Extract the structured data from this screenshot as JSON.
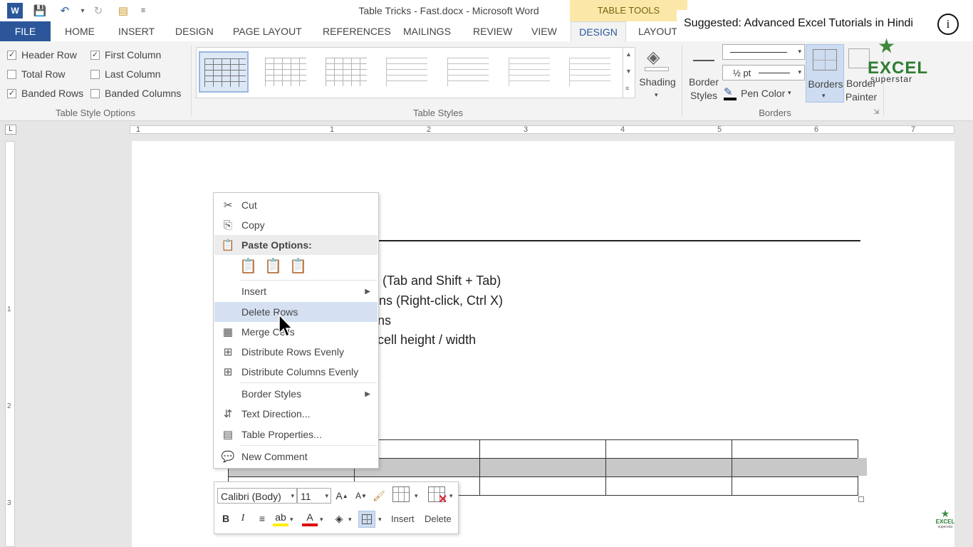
{
  "titlebar": {
    "title": "Table Tricks - Fast.docx - Microsoft Word",
    "table_tools": "TABLE TOOLS"
  },
  "tabs": {
    "file": "FILE",
    "home": "HOME",
    "insert": "INSERT",
    "design": "DESIGN",
    "page_layout": "PAGE LAYOUT",
    "references": "REFERENCES",
    "mailings": "MAILINGS",
    "review": "REVIEW",
    "view": "VIEW",
    "design2": "DESIGN",
    "layout": "LAYOUT"
  },
  "suggested": {
    "text": "Suggested: Advanced Excel Tutorials in Hindi",
    "info": "i"
  },
  "watermark": {
    "main": "EXCEL",
    "sub": "superstar",
    "small": "EXCEL",
    "small_sub": "superstar"
  },
  "style_options": {
    "header_row": {
      "label": "Header Row",
      "checked": "✓"
    },
    "total_row": {
      "label": "Total Row",
      "checked": ""
    },
    "banded_rows": {
      "label": "Banded Rows",
      "checked": "✓"
    },
    "first_column": {
      "label": "First Column",
      "checked": "✓"
    },
    "last_column": {
      "label": "Last Column",
      "checked": ""
    },
    "banded_columns": {
      "label": "Banded Columns",
      "checked": ""
    },
    "group_label": "Table Style Options"
  },
  "table_styles": {
    "group_label": "Table Styles",
    "shading": "Shading"
  },
  "borders": {
    "border_styles_1": "Border",
    "border_styles_2": "Styles",
    "weight": "½ pt",
    "pen_color": "Pen Color",
    "borders": "Borders",
    "painter_1": "Border",
    "painter_2": "Painter",
    "group_label": "Borders"
  },
  "ruler": {
    "marks": [
      "1",
      "1",
      "2",
      "3",
      "4",
      "5",
      "6",
      "7"
    ],
    "vmarks": [
      "1",
      "2",
      "3"
    ]
  },
  "document": {
    "lines": [
      "e (Tab and Shift + Tab)",
      "nns (Right-click, Ctrl X)",
      "ns",
      "cell height / width"
    ]
  },
  "context_menu": {
    "cut": "Cut",
    "copy": "Copy",
    "paste_options": "Paste Options:",
    "insert": "Insert",
    "delete_rows": "Delete Rows",
    "merge_cells": "Merge Cells",
    "distribute_rows": "Distribute Rows Evenly",
    "distribute_columns": "Distribute Columns Evenly",
    "border_styles": "Border Styles",
    "text_direction": "Text Direction...",
    "table_properties": "Table Properties...",
    "new_comment": "New Comment"
  },
  "mini_toolbar": {
    "font": "Calibri (Body)",
    "size": "11",
    "bold": "B",
    "italic": "I",
    "insert": "Insert",
    "delete": "Delete"
  },
  "colors": {
    "accent": "#2b579a",
    "table_tools": "#fbe8a8",
    "highlight": "#d5e1f2"
  }
}
